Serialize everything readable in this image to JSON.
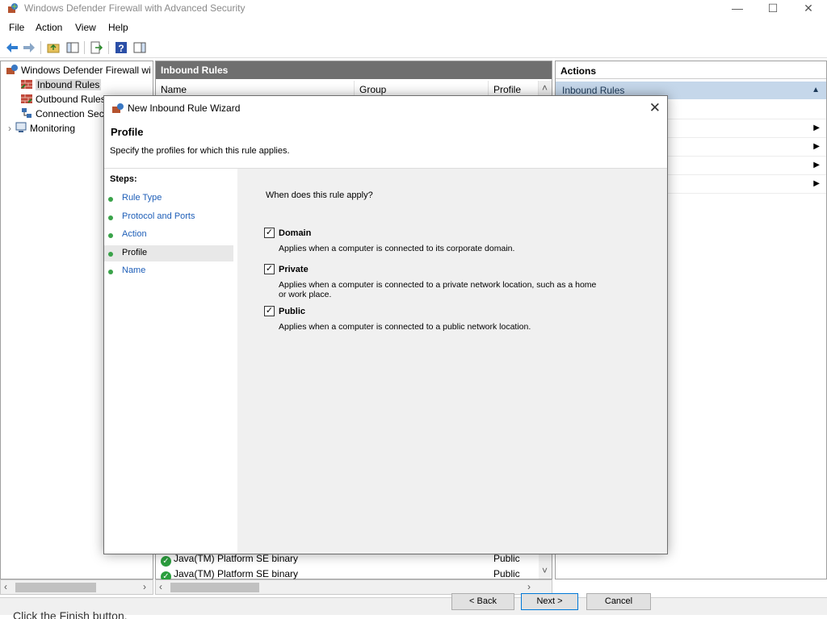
{
  "window": {
    "title": "Windows Defender Firewall with Advanced Security",
    "minimize": "—",
    "maximize": "☐",
    "close": "✕"
  },
  "menu": [
    "File",
    "Action",
    "View",
    "Help"
  ],
  "tree": {
    "root": "Windows Defender Firewall witl",
    "items": [
      "Inbound Rules",
      "Outbound Rules",
      "Connection Secu",
      "Monitoring"
    ],
    "expander": "›"
  },
  "center": {
    "header": "Inbound Rules",
    "columns": [
      "Name",
      "Group",
      "Profile"
    ],
    "rows": [
      {
        "name": "Java(TM) Platform SE binary",
        "profile": "Public"
      },
      {
        "name": "Java(TM) Platform SE binary",
        "profile": "Public"
      }
    ]
  },
  "actions": {
    "header": "Actions",
    "sub": "Inbound Rules"
  },
  "footer_text": "Click the Finish button.",
  "dialog": {
    "title": "New Inbound Rule Wizard",
    "heading": "Profile",
    "subtitle": "Specify the profiles for which this rule applies.",
    "steps_title": "Steps:",
    "steps": [
      "Rule Type",
      "Protocol and Ports",
      "Action",
      "Profile",
      "Name"
    ],
    "question": "When does this rule apply?",
    "options": [
      {
        "label": "Domain",
        "desc": "Applies when a computer is connected to its corporate domain.",
        "checked": true
      },
      {
        "label": "Private",
        "desc": "Applies when a computer is connected to a private network location, such as a home or work place.",
        "checked": true
      },
      {
        "label": "Public",
        "desc": "Applies when a computer is connected to a public network location.",
        "checked": true
      }
    ],
    "buttons": {
      "back": "< Back",
      "next": "Next >",
      "cancel": "Cancel"
    }
  }
}
